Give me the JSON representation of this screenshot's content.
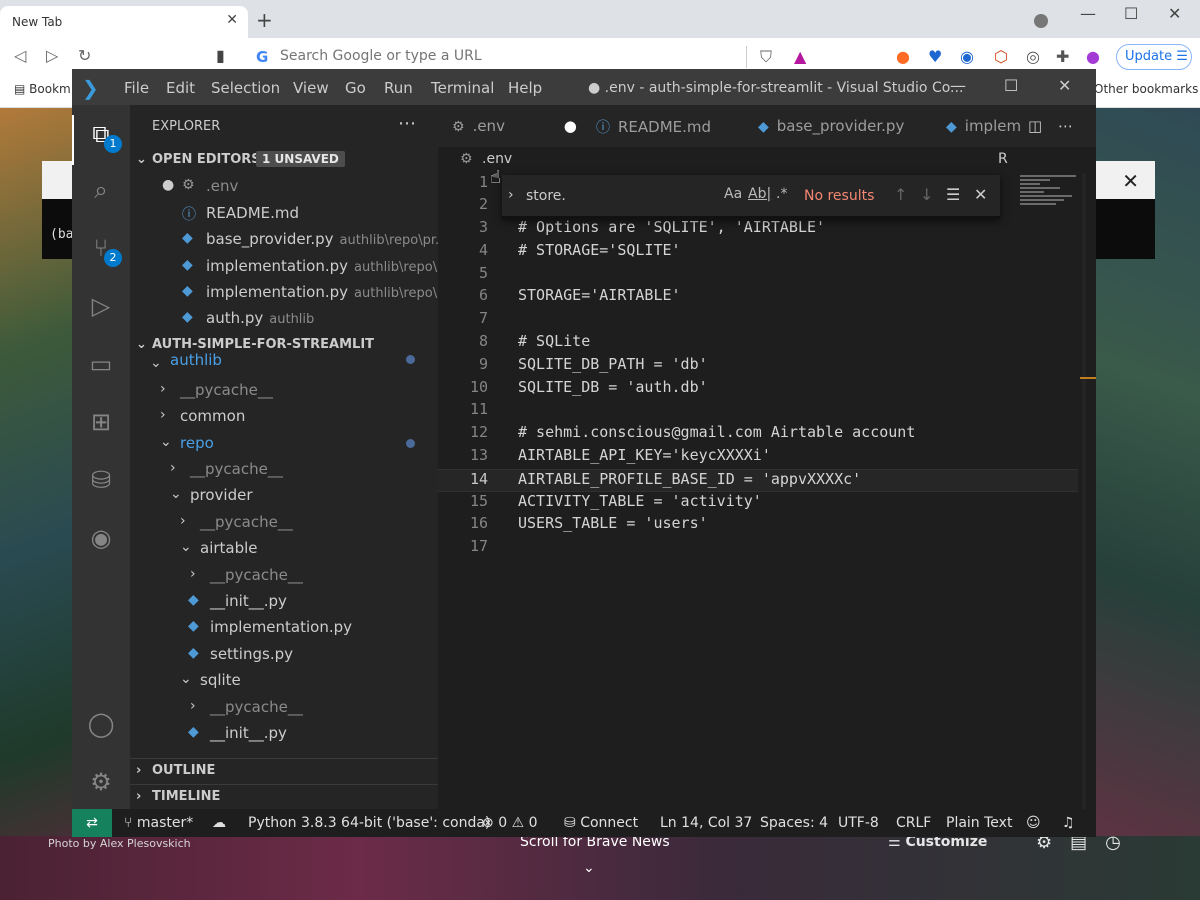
{
  "browser": {
    "tab_title": "New Tab",
    "tab_close": "✕",
    "new_tab": "+",
    "omnibox_placeholder": "Search Google or type a URL",
    "update_label": "Update",
    "bookmarks_left": "Bookm",
    "bookmarks_right": "Other bookmarks"
  },
  "background": {
    "terminal_prompt": "(ba",
    "photo_credit": "Photo by Alex Plesovskich",
    "scroll_news": "Scroll for Brave News",
    "customize": "Customize"
  },
  "vscode": {
    "menu": [
      "File",
      "Edit",
      "Selection",
      "View",
      "Go",
      "Run",
      "Terminal",
      "Help"
    ],
    "window_title": "● .env - auth-simple-for-streamlit - Visual Studio Co...",
    "activity_badges": {
      "explorer": "1",
      "scm": "2"
    },
    "sidebar": {
      "title": "EXPLORER",
      "open_editors": {
        "label": "OPEN EDITORS",
        "badge": "1 UNSAVED",
        "items": [
          {
            "name": ".env",
            "desc": ""
          },
          {
            "name": "README.md",
            "desc": ""
          },
          {
            "name": "base_provider.py",
            "desc": "authlib\\repo\\pr..."
          },
          {
            "name": "implementation.py",
            "desc": "authlib\\repo\\..."
          },
          {
            "name": "implementation.py",
            "desc": "authlib\\repo\\..."
          },
          {
            "name": "auth.py",
            "desc": "authlib"
          }
        ]
      },
      "project": {
        "label": "AUTH-SIMPLE-FOR-STREAMLIT",
        "tree": [
          "authlib",
          "__pycache__",
          "common",
          "repo",
          "__pycache__",
          "provider",
          "__pycache__",
          "airtable",
          "__pycache__",
          "__init__.py",
          "implementation.py",
          "settings.py",
          "sqlite",
          "__pycache__",
          "__init__.py"
        ]
      },
      "outline": "OUTLINE",
      "timeline": "TIMELINE"
    },
    "tabs": [
      {
        "label": ".env"
      },
      {
        "label": "README.md"
      },
      {
        "label": "base_provider.py"
      },
      {
        "label": "implem"
      }
    ],
    "breadcrumb": ".env",
    "breadcrumb_tail": "R",
    "find": {
      "value": "store.",
      "aa": "Aa",
      "ab": "Ab|",
      "regex": ".*",
      "result": "No results"
    },
    "lines": [
      {
        "n": "1",
        "code": ""
      },
      {
        "n": "2",
        "code": ""
      },
      {
        "n": "3",
        "code": "# Options are 'SQLITE', 'AIRTABLE'"
      },
      {
        "n": "4",
        "code": "# STORAGE='SQLITE'"
      },
      {
        "n": "5",
        "code": ""
      },
      {
        "n": "6",
        "code": "STORAGE='AIRTABLE'"
      },
      {
        "n": "7",
        "code": ""
      },
      {
        "n": "8",
        "code": "# SQLite"
      },
      {
        "n": "9",
        "code": "SQLITE_DB_PATH = 'db'"
      },
      {
        "n": "10",
        "code": "SQLITE_DB = 'auth.db'"
      },
      {
        "n": "11",
        "code": ""
      },
      {
        "n": "12",
        "code": "# sehmi.conscious@gmail.com Airtable account"
      },
      {
        "n": "13",
        "code": "AIRTABLE_API_KEY='keycXXXXi'"
      },
      {
        "n": "14",
        "code": "AIRTABLE_PROFILE_BASE_ID = 'appvXXXXc'"
      },
      {
        "n": "15",
        "code": "ACTIVITY_TABLE = 'activity'"
      },
      {
        "n": "16",
        "code": "USERS_TABLE = 'users'"
      },
      {
        "n": "17",
        "code": ""
      }
    ],
    "status": {
      "branch": "master*",
      "python": "Python 3.8.3 64-bit ('base': conda)",
      "errors": "0",
      "warnings": "0",
      "connect": "Connect",
      "position": "Ln 14, Col 37",
      "spaces": "Spaces: 4",
      "encoding": "UTF-8",
      "eol": "CRLF",
      "language": "Plain Text"
    }
  }
}
